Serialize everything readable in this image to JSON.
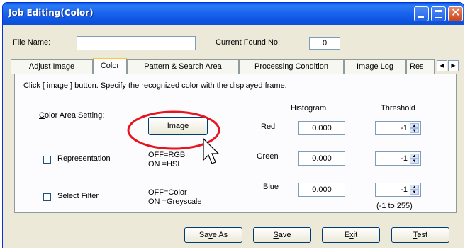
{
  "window": {
    "title": "Job Editing(Color)"
  },
  "header": {
    "file_name_label": "File Name:",
    "file_name_value": "",
    "current_found_label": "Current Found No:",
    "current_found_value": "0"
  },
  "tabs": [
    {
      "label": "Adjust Image"
    },
    {
      "label": "Color"
    },
    {
      "label": "Pattern & Search Area"
    },
    {
      "label": "Processing Condition"
    },
    {
      "label": "Image Log"
    },
    {
      "label": "Res"
    }
  ],
  "panel": {
    "instruction": "Click [ image ] button.   Specify the recognized color with the displayed frame.",
    "color_area_label": "Color Area Setting:",
    "image_button_label": "Image",
    "representation_label": "Representation",
    "representation_hint_line1": "OFF=RGB",
    "representation_hint_line2": "ON =HSI",
    "select_filter_label": "Select Filter",
    "select_filter_hint_line1": "OFF=Color",
    "select_filter_hint_line2": "ON =Greyscale",
    "histogram_header": "Histogram",
    "threshold_header": "Threshold",
    "range_note": "(-1 to 255)",
    "channels": [
      {
        "name": "Red",
        "histogram": "0.000",
        "threshold": "-1"
      },
      {
        "name": "Green",
        "histogram": "0.000",
        "threshold": "-1"
      },
      {
        "name": "Blue",
        "histogram": "0.000",
        "threshold": "-1"
      }
    ]
  },
  "footer": {
    "save_as_label": "Save As",
    "save_label": "Save",
    "exit_label": "Exit",
    "test_label": "Test"
  },
  "colors": {
    "titlebar": "#0a5be8",
    "annotation_circle": "#e8141e",
    "window_bg": "#ece9d8"
  }
}
